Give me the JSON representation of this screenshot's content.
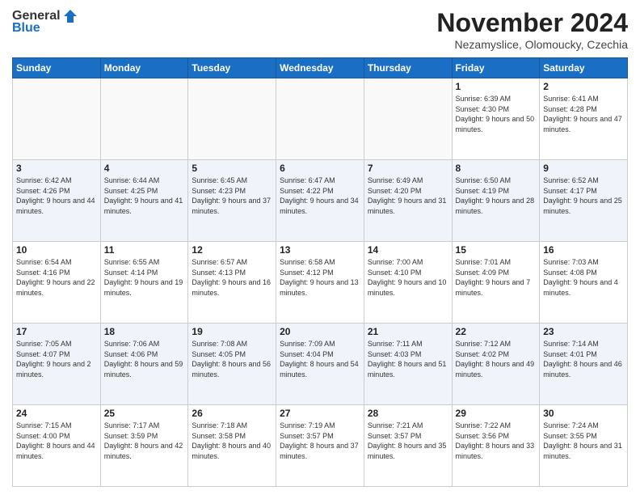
{
  "logo": {
    "general": "General",
    "blue": "Blue"
  },
  "title": "November 2024",
  "location": "Nezamyslice, Olomoucky, Czechia",
  "days_of_week": [
    "Sunday",
    "Monday",
    "Tuesday",
    "Wednesday",
    "Thursday",
    "Friday",
    "Saturday"
  ],
  "weeks": [
    [
      {
        "day": "",
        "info": ""
      },
      {
        "day": "",
        "info": ""
      },
      {
        "day": "",
        "info": ""
      },
      {
        "day": "",
        "info": ""
      },
      {
        "day": "",
        "info": ""
      },
      {
        "day": "1",
        "info": "Sunrise: 6:39 AM\nSunset: 4:30 PM\nDaylight: 9 hours\nand 50 minutes."
      },
      {
        "day": "2",
        "info": "Sunrise: 6:41 AM\nSunset: 4:28 PM\nDaylight: 9 hours\nand 47 minutes."
      }
    ],
    [
      {
        "day": "3",
        "info": "Sunrise: 6:42 AM\nSunset: 4:26 PM\nDaylight: 9 hours\nand 44 minutes."
      },
      {
        "day": "4",
        "info": "Sunrise: 6:44 AM\nSunset: 4:25 PM\nDaylight: 9 hours\nand 41 minutes."
      },
      {
        "day": "5",
        "info": "Sunrise: 6:45 AM\nSunset: 4:23 PM\nDaylight: 9 hours\nand 37 minutes."
      },
      {
        "day": "6",
        "info": "Sunrise: 6:47 AM\nSunset: 4:22 PM\nDaylight: 9 hours\nand 34 minutes."
      },
      {
        "day": "7",
        "info": "Sunrise: 6:49 AM\nSunset: 4:20 PM\nDaylight: 9 hours\nand 31 minutes."
      },
      {
        "day": "8",
        "info": "Sunrise: 6:50 AM\nSunset: 4:19 PM\nDaylight: 9 hours\nand 28 minutes."
      },
      {
        "day": "9",
        "info": "Sunrise: 6:52 AM\nSunset: 4:17 PM\nDaylight: 9 hours\nand 25 minutes."
      }
    ],
    [
      {
        "day": "10",
        "info": "Sunrise: 6:54 AM\nSunset: 4:16 PM\nDaylight: 9 hours\nand 22 minutes."
      },
      {
        "day": "11",
        "info": "Sunrise: 6:55 AM\nSunset: 4:14 PM\nDaylight: 9 hours\nand 19 minutes."
      },
      {
        "day": "12",
        "info": "Sunrise: 6:57 AM\nSunset: 4:13 PM\nDaylight: 9 hours\nand 16 minutes."
      },
      {
        "day": "13",
        "info": "Sunrise: 6:58 AM\nSunset: 4:12 PM\nDaylight: 9 hours\nand 13 minutes."
      },
      {
        "day": "14",
        "info": "Sunrise: 7:00 AM\nSunset: 4:10 PM\nDaylight: 9 hours\nand 10 minutes."
      },
      {
        "day": "15",
        "info": "Sunrise: 7:01 AM\nSunset: 4:09 PM\nDaylight: 9 hours\nand 7 minutes."
      },
      {
        "day": "16",
        "info": "Sunrise: 7:03 AM\nSunset: 4:08 PM\nDaylight: 9 hours\nand 4 minutes."
      }
    ],
    [
      {
        "day": "17",
        "info": "Sunrise: 7:05 AM\nSunset: 4:07 PM\nDaylight: 9 hours\nand 2 minutes."
      },
      {
        "day": "18",
        "info": "Sunrise: 7:06 AM\nSunset: 4:06 PM\nDaylight: 8 hours\nand 59 minutes."
      },
      {
        "day": "19",
        "info": "Sunrise: 7:08 AM\nSunset: 4:05 PM\nDaylight: 8 hours\nand 56 minutes."
      },
      {
        "day": "20",
        "info": "Sunrise: 7:09 AM\nSunset: 4:04 PM\nDaylight: 8 hours\nand 54 minutes."
      },
      {
        "day": "21",
        "info": "Sunrise: 7:11 AM\nSunset: 4:03 PM\nDaylight: 8 hours\nand 51 minutes."
      },
      {
        "day": "22",
        "info": "Sunrise: 7:12 AM\nSunset: 4:02 PM\nDaylight: 8 hours\nand 49 minutes."
      },
      {
        "day": "23",
        "info": "Sunrise: 7:14 AM\nSunset: 4:01 PM\nDaylight: 8 hours\nand 46 minutes."
      }
    ],
    [
      {
        "day": "24",
        "info": "Sunrise: 7:15 AM\nSunset: 4:00 PM\nDaylight: 8 hours\nand 44 minutes."
      },
      {
        "day": "25",
        "info": "Sunrise: 7:17 AM\nSunset: 3:59 PM\nDaylight: 8 hours\nand 42 minutes."
      },
      {
        "day": "26",
        "info": "Sunrise: 7:18 AM\nSunset: 3:58 PM\nDaylight: 8 hours\nand 40 minutes."
      },
      {
        "day": "27",
        "info": "Sunrise: 7:19 AM\nSunset: 3:57 PM\nDaylight: 8 hours\nand 37 minutes."
      },
      {
        "day": "28",
        "info": "Sunrise: 7:21 AM\nSunset: 3:57 PM\nDaylight: 8 hours\nand 35 minutes."
      },
      {
        "day": "29",
        "info": "Sunrise: 7:22 AM\nSunset: 3:56 PM\nDaylight: 8 hours\nand 33 minutes."
      },
      {
        "day": "30",
        "info": "Sunrise: 7:24 AM\nSunset: 3:55 PM\nDaylight: 8 hours\nand 31 minutes."
      }
    ]
  ]
}
